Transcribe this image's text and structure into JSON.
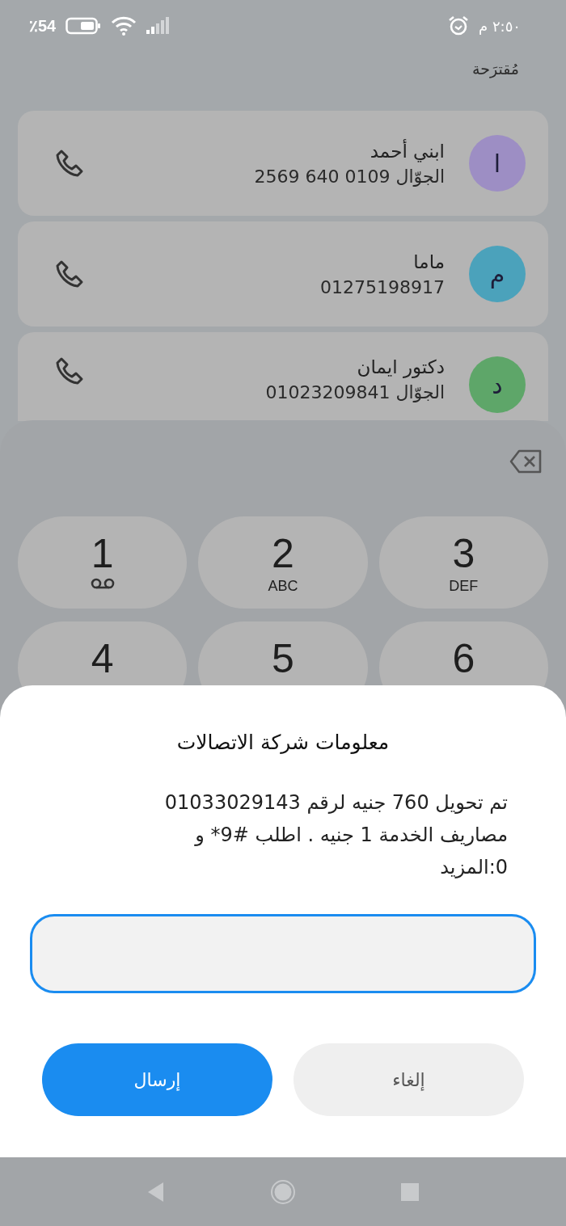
{
  "status_bar": {
    "battery": "٪54",
    "time": "٢:٥٠ م"
  },
  "suggested": {
    "title": "مُقترَحة",
    "contacts": [
      {
        "name": "ابني أحمد",
        "detail": "الجوّال 0109 640 2569",
        "initial": "ا",
        "color": "#9d8ec4"
      },
      {
        "name": "ماما",
        "detail": "01275198917",
        "initial": "م",
        "color": "#4ba2bb"
      },
      {
        "name": "دكتور ايمان",
        "detail": "الجوّال 01023209841",
        "initial": "د",
        "color": "#5ea669"
      }
    ]
  },
  "keypad": {
    "keys": [
      {
        "digit": "3",
        "kind": "letters",
        "letters": "DEF"
      },
      {
        "digit": "2",
        "kind": "letters",
        "letters": "ABC"
      },
      {
        "digit": "1",
        "kind": "voicemail"
      },
      {
        "digit": "6",
        "kind": "plain"
      },
      {
        "digit": "5",
        "kind": "plain"
      },
      {
        "digit": "4",
        "kind": "plain"
      }
    ]
  },
  "dialog": {
    "title": "معلومات شركة الاتصالات",
    "message": "تم تحويل 760 جنيه لرقم 01033029143\nمصاريف الخدمة 1 جنيه . اطلب #9* و\n0:المزيد",
    "field": {
      "focused": true
    },
    "buttons": [
      {
        "label": "إلغاء",
        "kind": "secondary"
      },
      {
        "label": "إرسال",
        "kind": "primary"
      }
    ]
  }
}
